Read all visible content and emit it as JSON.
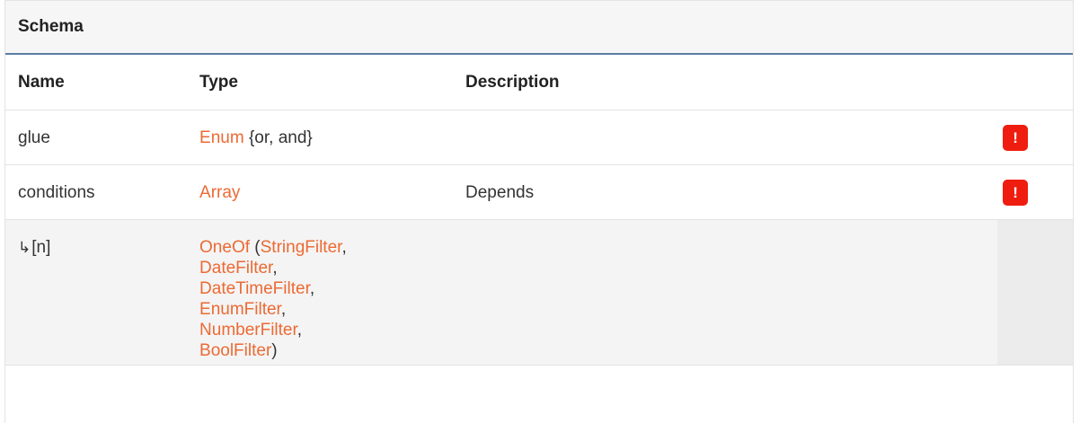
{
  "header": {
    "title": "Schema"
  },
  "columns": {
    "name": "Name",
    "type": "Type",
    "description": "Description"
  },
  "rows": [
    {
      "name": "glue",
      "type_link": "Enum",
      "type_rest": " {or, and}",
      "description": "",
      "required_badge": "!"
    },
    {
      "name": "conditions",
      "type_link": "Array",
      "description": "Depends",
      "required_badge": "!"
    },
    {
      "name_arrow": "↳",
      "name": "[n]",
      "type_prefix_link": "OneOf",
      "type_open": " (",
      "types": [
        "StringFilter",
        "DateFilter",
        "DateTimeFilter",
        "EnumFilter",
        "NumberFilter",
        "BoolFilter"
      ],
      "separator": ",",
      "type_close": ")"
    }
  ],
  "colors": {
    "link": "#ec6a33",
    "badge": "#ef1d10",
    "header_border": "#5b7ea4"
  }
}
